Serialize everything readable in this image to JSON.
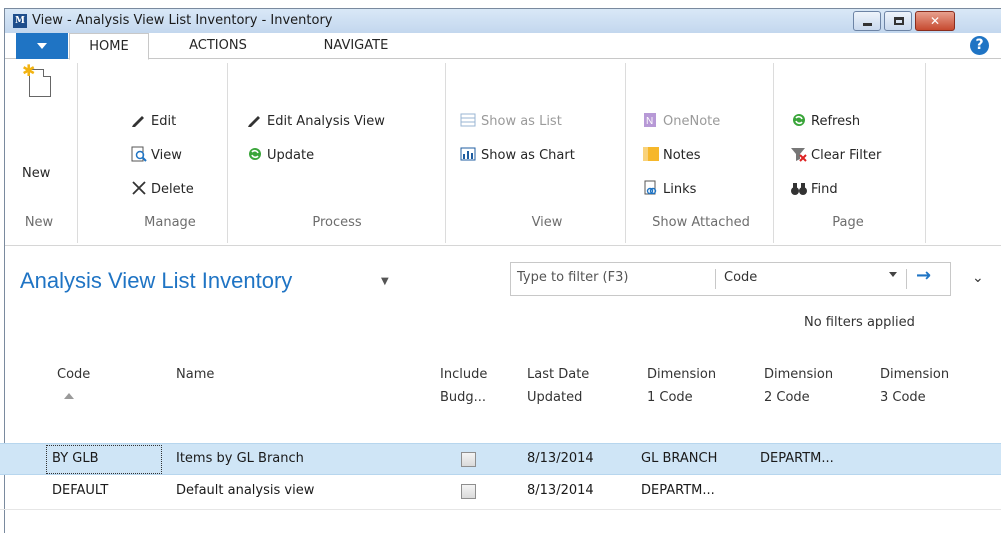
{
  "window": {
    "title": "View - Analysis View List Inventory - Inventory"
  },
  "ribbon_tabs": {
    "home": "HOME",
    "actions": "ACTIONS",
    "navigate": "NAVIGATE"
  },
  "ribbon": {
    "new": {
      "button": "New",
      "group": "New"
    },
    "manage": {
      "edit": "Edit",
      "view": "View",
      "delete": "Delete",
      "group": "Manage"
    },
    "process": {
      "edit_analysis_view": "Edit Analysis View",
      "update": "Update",
      "group": "Process"
    },
    "view": {
      "show_as_list": "Show as List",
      "show_as_chart": "Show as Chart",
      "group": "View"
    },
    "show_attached": {
      "onenote": "OneNote",
      "notes": "Notes",
      "links": "Links",
      "group": "Show Attached"
    },
    "page": {
      "refresh": "Refresh",
      "clear_filter": "Clear Filter",
      "find": "Find",
      "group": "Page"
    }
  },
  "page": {
    "title": "Analysis View List Inventory",
    "filter_placeholder": "Type to filter (F3)",
    "filter_field": "Code",
    "no_filters": "No filters applied"
  },
  "table": {
    "headers": {
      "code": "Code",
      "name": "Name",
      "include_budgets_1": "Include",
      "include_budgets_2": "Budg...",
      "last_date_1": "Last Date",
      "last_date_2": "Updated",
      "dim1_1": "Dimension",
      "dim1_2": "1 Code",
      "dim2_1": "Dimension",
      "dim2_2": "2 Code",
      "dim3_1": "Dimension",
      "dim3_2": "3 Code"
    },
    "rows": [
      {
        "code": "BY GLB",
        "name": "Items by GL Branch",
        "include_budgets": false,
        "last_date": "8/13/2014",
        "dim1": "GL BRANCH",
        "dim2": "DEPARTM...",
        "dim3": ""
      },
      {
        "code": "DEFAULT",
        "name": "Default analysis view",
        "include_budgets": false,
        "last_date": "8/13/2014",
        "dim1": "DEPARTM...",
        "dim2": "",
        "dim3": ""
      }
    ]
  },
  "colors": {
    "accent": "#1f74c4",
    "selected_row": "#cfe5f6",
    "disabled_text": "#9a9a9a"
  }
}
